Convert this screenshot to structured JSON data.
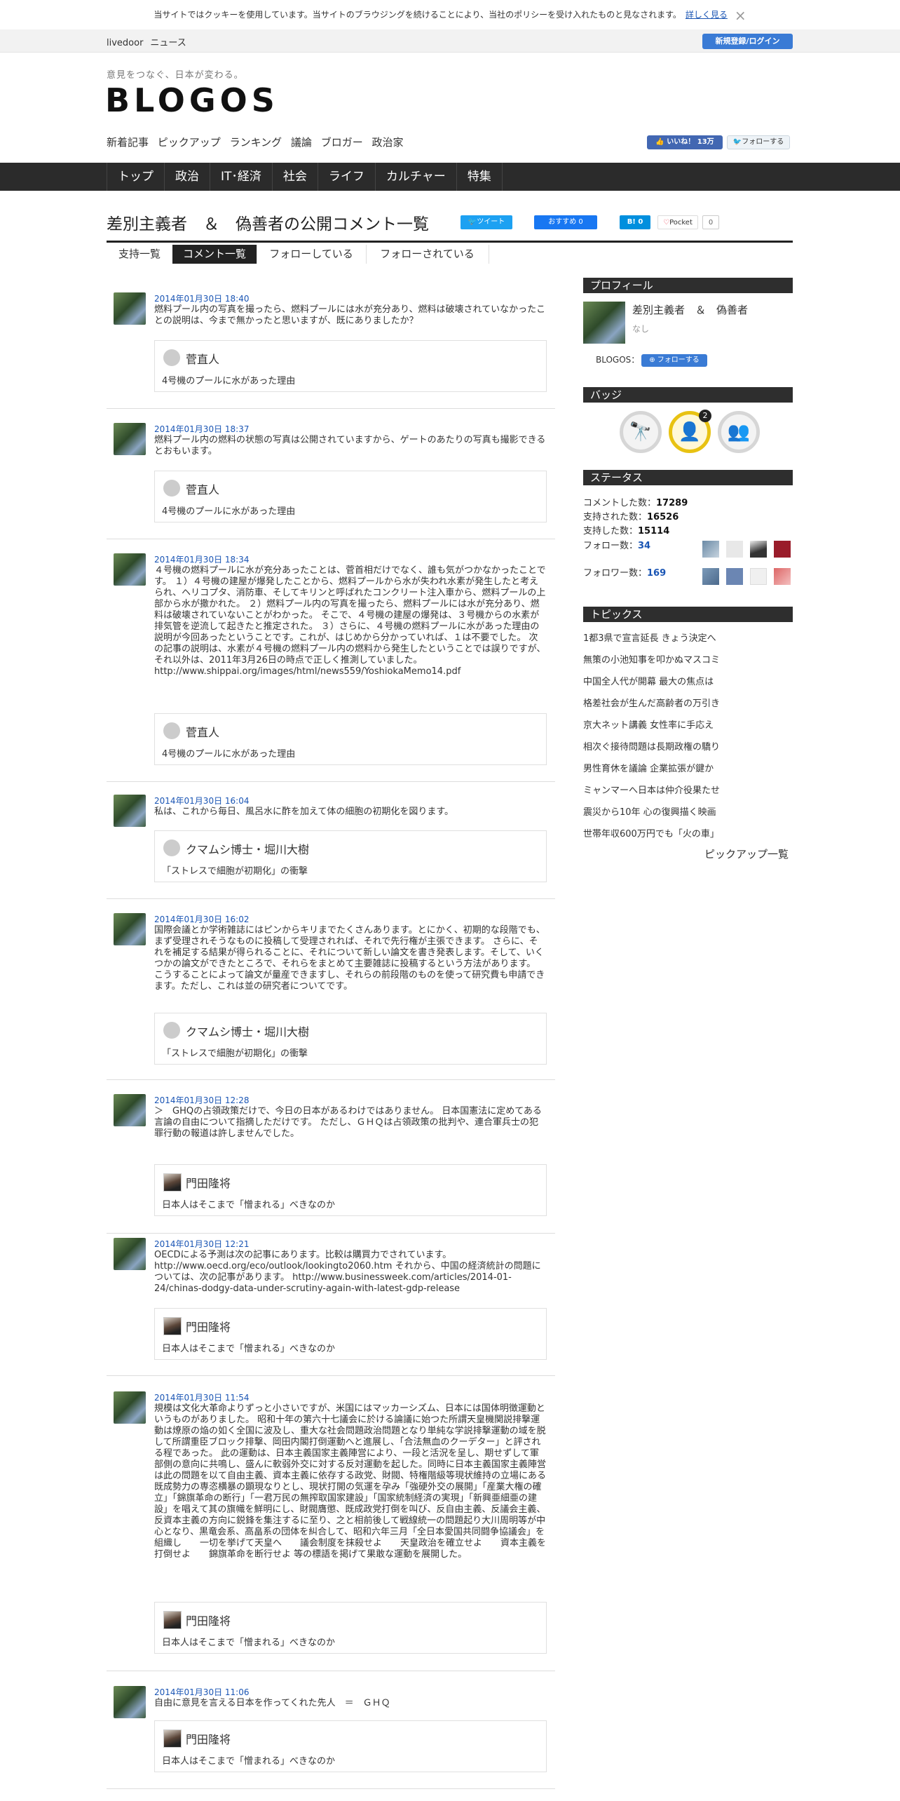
{
  "cookie": {
    "text": "当サイトではクッキーを使用しています。当サイトのブラウジングを続けることにより、当社のポリシーを受け入れたものと見なされます。",
    "more": "詳しく見る",
    "close": "×"
  },
  "topbar": {
    "site": "livedoor",
    "news": "ニュース",
    "login": "新規登録/ログイン"
  },
  "header": {
    "tagline": "意見をつなぐ、日本が変わる。",
    "logo": "BLOGOS",
    "subnav": [
      "新着記事",
      "ピックアップ",
      "ランキング",
      "議論",
      "ブロガー",
      "政治家"
    ],
    "fb_like": "👍 いいね！ 13万",
    "tw_follow": "フォローする"
  },
  "nav": [
    "トップ",
    "政治",
    "IT･経済",
    "社会",
    "ライフ",
    "カルチャー",
    "特集"
  ],
  "page": {
    "title": "差別主義者　＆　偽善者の公開コメント一覧",
    "tweet": "ツイート",
    "fb_recommend": "おすすめ 0",
    "hatena": "B! 0",
    "pocket": "Pocket",
    "pocket_count": "0",
    "tabs": [
      "支持一覧",
      "コメント一覧",
      "フォローしている",
      "フォローされている"
    ]
  },
  "comments": [
    {
      "time": "2014年01月30日 18:40",
      "body": "燃料プール内の写真を撮ったら、燃料プールには水が充分あり、燃料は破壊されていなかったことの説明は、今まで無かったと思いますが、既にありましたか？",
      "ref_name": "菅直人",
      "ref_title": "4号機のプールに水があった理由"
    },
    {
      "time": "2014年01月30日 18:37",
      "body": "燃料プール内の燃料の状態の写真は公開されていますから、ゲートのあたりの写真も撮影できるとおもいます。",
      "ref_name": "菅直人",
      "ref_title": "4号機のプールに水があった理由"
    },
    {
      "time": "2014年01月30日 18:34",
      "body": "４号機の燃料プールに水が充分あったことは、菅首相だけでなく、誰も気がつかなかったことです。 １）４号機の建屋が爆発したことから、燃料プールから水が失われ水素が発生したと考えられ、ヘリコプタ、消防車、そしてキリンと呼ばれたコンクリート注入車から、燃料プールの上部から水が撒かれた。 ２）燃料プール内の写真を撮ったら、燃料プールには水が充分あり、燃料は破壊されていないことがわかった。 そこで、４号機の建屋の爆発は、３号機からの水素が排気管を逆流して起きたと推定された。 ３）さらに、４号機の燃料プールに水があった理由の説明が今回あったということです。これが、はじめから分かっていれば、１は不要でした。 次の記事の説明は、水素が４号機の燃料プール内の燃料から発生したということでは誤りですが、それ以外は、2011年3月26日の時点で正しく推測していました。 http://www.shippai.org/images/html/news559/YoshiokaMemo14.pdf",
      "ref_name": "菅直人",
      "ref_title": "4号機のプールに水があった理由"
    },
    {
      "time": "2014年01月30日 16:04",
      "body": "私は、これから毎日、風呂水に酢を加えて体の細胞の初期化を図ります。",
      "ref_name": "クマムシ博士・堀川大樹",
      "ref_title": "「ストレスで細胞が初期化」の衝撃"
    },
    {
      "time": "2014年01月30日 16:02",
      "body": "国際会議とか学術雑誌にはピンからキリまでたくさんあります。とにかく、初期的な段階でも、まず受理されそうなものに投稿して受理されれば、それで先行権が主張できます。 さらに、それを補足する結果が得られることに、それについて新しい論文を書き発表します。そして、いくつかの論文ができたところで、それらをまとめて主要雑誌に投稿するという方法があります。 こうすることによって論文が量産できますし、それらの前段階のものを使って研究費も申請できます。ただし、これは並の研究者についてです。",
      "ref_name": "クマムシ博士・堀川大樹",
      "ref_title": "「ストレスで細胞が初期化」の衝撃"
    },
    {
      "time": "2014年01月30日 12:28",
      "body": "＞　GHQの占領政策だけで、今日の日本があるわけではありません。 日本国憲法に定めてある言論の自由について指摘しただけです。 ただし、ＧＨＱは占領政策の批判や、連合軍兵士の犯罪行動の報道は許しませんでした。",
      "ref_name": "門田隆将",
      "ref_title": "日本人はそこまで「憎まれる」べきなのか"
    },
    {
      "time": "2014年01月30日 12:21",
      "body": "OECDによる予測は次の記事にあります。比較は購買力でされています。 http://www.oecd.org/eco/outlook/lookingto2060.htm それから、中国の経済統計の問題については、次の記事があります。 http://www.businessweek.com/articles/2014-01-24/chinas-dodgy-data-under-scrutiny-again-with-latest-gdp-release",
      "ref_name": "門田隆将",
      "ref_title": "日本人はそこまで「憎まれる」べきなのか"
    },
    {
      "time": "2014年01月30日 11:54",
      "body": "規模は文化大革命よりずっと小さいですが、米国にはマッカーシズム、日本には国体明徴運動というものがありました。 昭和十年の第六十七議会に於ける論議に始つた所謂天皇機関説排撃運動は燎原の焔の如く全国に波及し、重大な社会問題政治問題となり単純な学説排撃運動の域を脱して所謂重臣ブロック排撃、岡田内閣打倒運動へと進展し、「合法無血のクーデター」と評される程であった。 此の運動は、日本主義国家主義陣営により、一段と活況を呈し、期せずして軍部側の意向に共鳴し、盛んに軟弱外交に対する反対運動を起した。同時に日本主義国家主義陣営は此の問題を以て自由主義、資本主義に依存する政党、財閥、特権階級等現状維持の立場にある既成勢力の専恣横暴の顕現なりとし、現状打開の気運を孕み「強硬外交の展開」「産業大権の確立」「錦旗革命の断行」「一君万民の無搾取国家建設」「国家統制経済の実現」「新興亜細亜の建設」を唱えて其の旗幟を鮮明にし、財閥膺懲、既成政党打倒を叫び、反自由主義、反議会主義、反資本主義の方向に鋭鋒を集注するに至り、之と相前後して戦線統一の問題起り大川周明等が中心となり、黒竜会系、高畠系の団体を糾合して、昭和六年三月「全日本愛国共同闘争協議会」を組織し　　一切を挙げて天皇へ　　議会制度を抹殺せよ　　天皇政治を確立せよ　　資本主義を打倒せよ　　錦旗革命を断行せよ 等の標語を掲げて果敢な運動を展開した。",
      "ref_name": "門田隆将",
      "ref_title": "日本人はそこまで「憎まれる」べきなのか"
    },
    {
      "time": "2014年01月30日 11:06",
      "body": "自由に意見を言える日本を作ってくれた先人　＝　ＧＨＱ",
      "ref_name": "門田隆将",
      "ref_title": "日本人はそこまで「憎まれる」べきなのか"
    }
  ],
  "sidebar": {
    "profile_head": "プロフィール",
    "profile_name": "差別主義者　＆　偽善者",
    "profile_none": "なし",
    "blogos_label": "BLOGOS：",
    "follow_btn": "フォローする",
    "badge_head": "バッジ",
    "badge_count": "2",
    "status_head": "ステータス",
    "stats": {
      "comments_label": "コメントした数：",
      "comments": "17289",
      "supported_label": "支持された数：",
      "supported": "16526",
      "support_label": "支持した数：",
      "support": "15114",
      "follow_label": "フォロー数：",
      "follow": "34",
      "follower_label": "フォロワー数：",
      "follower": "169"
    },
    "topics_head": "トピックス",
    "topics": [
      "1都3県で宣言延長 きょう決定へ",
      "無策の小池知事を叩かぬマスコミ",
      "中国全人代が開幕 最大の焦点は",
      "格差社会が生んだ高齢者の万引き",
      "京大ネット講義 女性率に手応え",
      "相次ぐ接待問題は長期政権の驕り",
      "男性育休を議論 企業拡張が鍵か",
      "ミャンマーへ日本は仲介役果たせ",
      "震災から10年 心の復興描く映画",
      "世帯年収600万円でも「火の車」"
    ],
    "topics_more": "ピックアップ一覧"
  }
}
